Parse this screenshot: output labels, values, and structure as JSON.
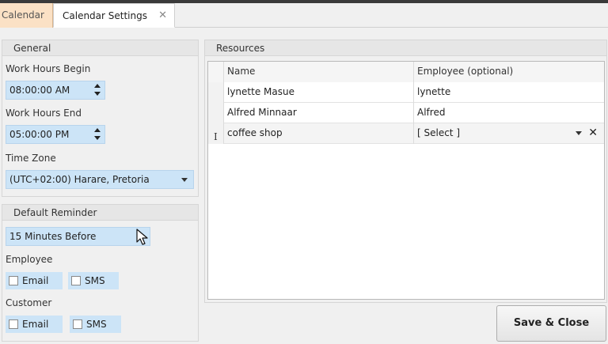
{
  "tabs": [
    {
      "label": "Calendar"
    },
    {
      "label": "Calendar Settings",
      "close_icon": "close-icon"
    }
  ],
  "general": {
    "title": "General",
    "work_hours_begin_label": "Work Hours Begin",
    "work_hours_begin_value": "08:00:00 AM",
    "work_hours_end_label": "Work Hours End",
    "work_hours_end_value": "05:00:00 PM",
    "time_zone_label": "Time Zone",
    "time_zone_value": "(UTC+02:00) Harare, Pretoria"
  },
  "reminder": {
    "title": "Default Reminder",
    "value": "15 Minutes Before",
    "employee_label": "Employee",
    "customer_label": "Customer",
    "email_label": "Email",
    "sms_label": "SMS"
  },
  "resources": {
    "title": "Resources",
    "columns": [
      "Name",
      "Employee (optional)"
    ],
    "rows": [
      {
        "name": "lynette Masue",
        "employee": "lynette"
      },
      {
        "name": "Alfred Minnaar",
        "employee": "Alfred"
      },
      {
        "name": "coffee shop",
        "employee": "[ Select ]"
      }
    ],
    "edit_cursor": "I",
    "clear_glyph": "✕"
  },
  "actions": {
    "save_close_label": "Save & Close"
  },
  "colors": {
    "active_tab": "#ffffff",
    "inactive_tab": "#fbe1c5",
    "field_bg": "#cce4f7"
  }
}
